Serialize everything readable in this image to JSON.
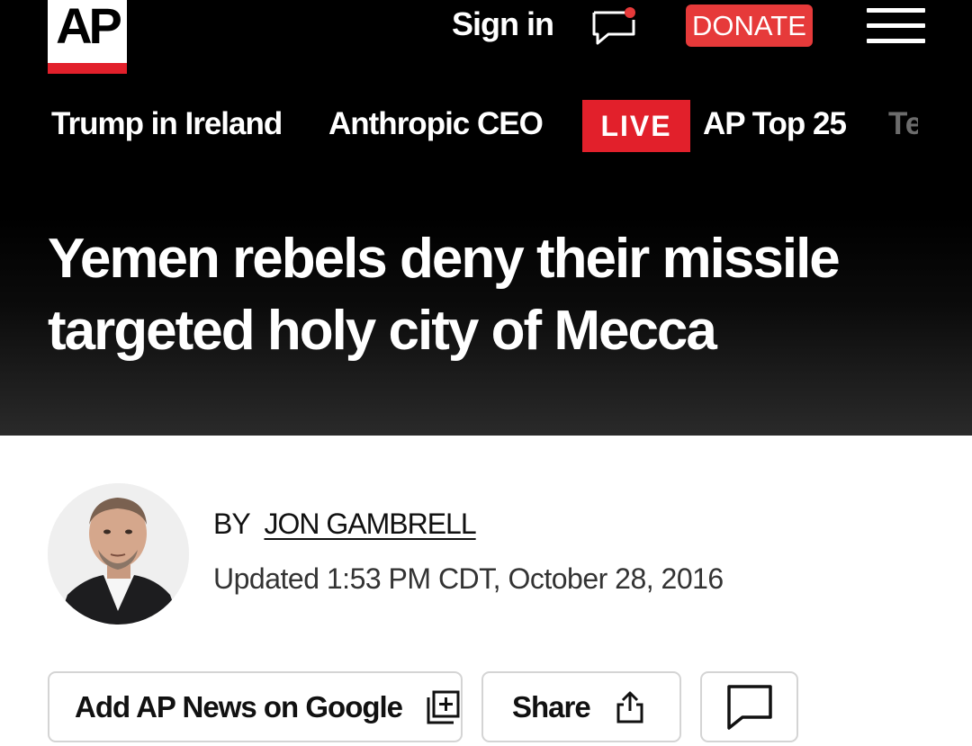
{
  "header": {
    "logo_text": "AP",
    "sign_in": "Sign in",
    "donate": "DONATE",
    "icons": {
      "logo": "ap-logo",
      "chat": "chat-bubble-icon",
      "menu": "hamburger-menu-icon"
    }
  },
  "nav": {
    "items": [
      "Trump in Ireland",
      "Anthropic CEO"
    ],
    "live_badge": "LIVE",
    "live_item": "AP Top 25",
    "clipped_item": "Te"
  },
  "article": {
    "headline": "Yemen rebels deny their missile targeted holy city of Mecca",
    "byline_prefix": "BY",
    "author": "JON GAMBRELL",
    "updated": "Updated 1:53 PM CDT, October 28, 2016"
  },
  "actions": {
    "add_google": "Add AP News on Google",
    "share": "Share",
    "icons": {
      "add_google": "add-to-google-icon",
      "share": "share-icon",
      "comment": "comment-icon"
    }
  },
  "colors": {
    "accent_red": "#e2202b",
    "donate_red": "#e63a3a",
    "header_bg": "#000000"
  }
}
